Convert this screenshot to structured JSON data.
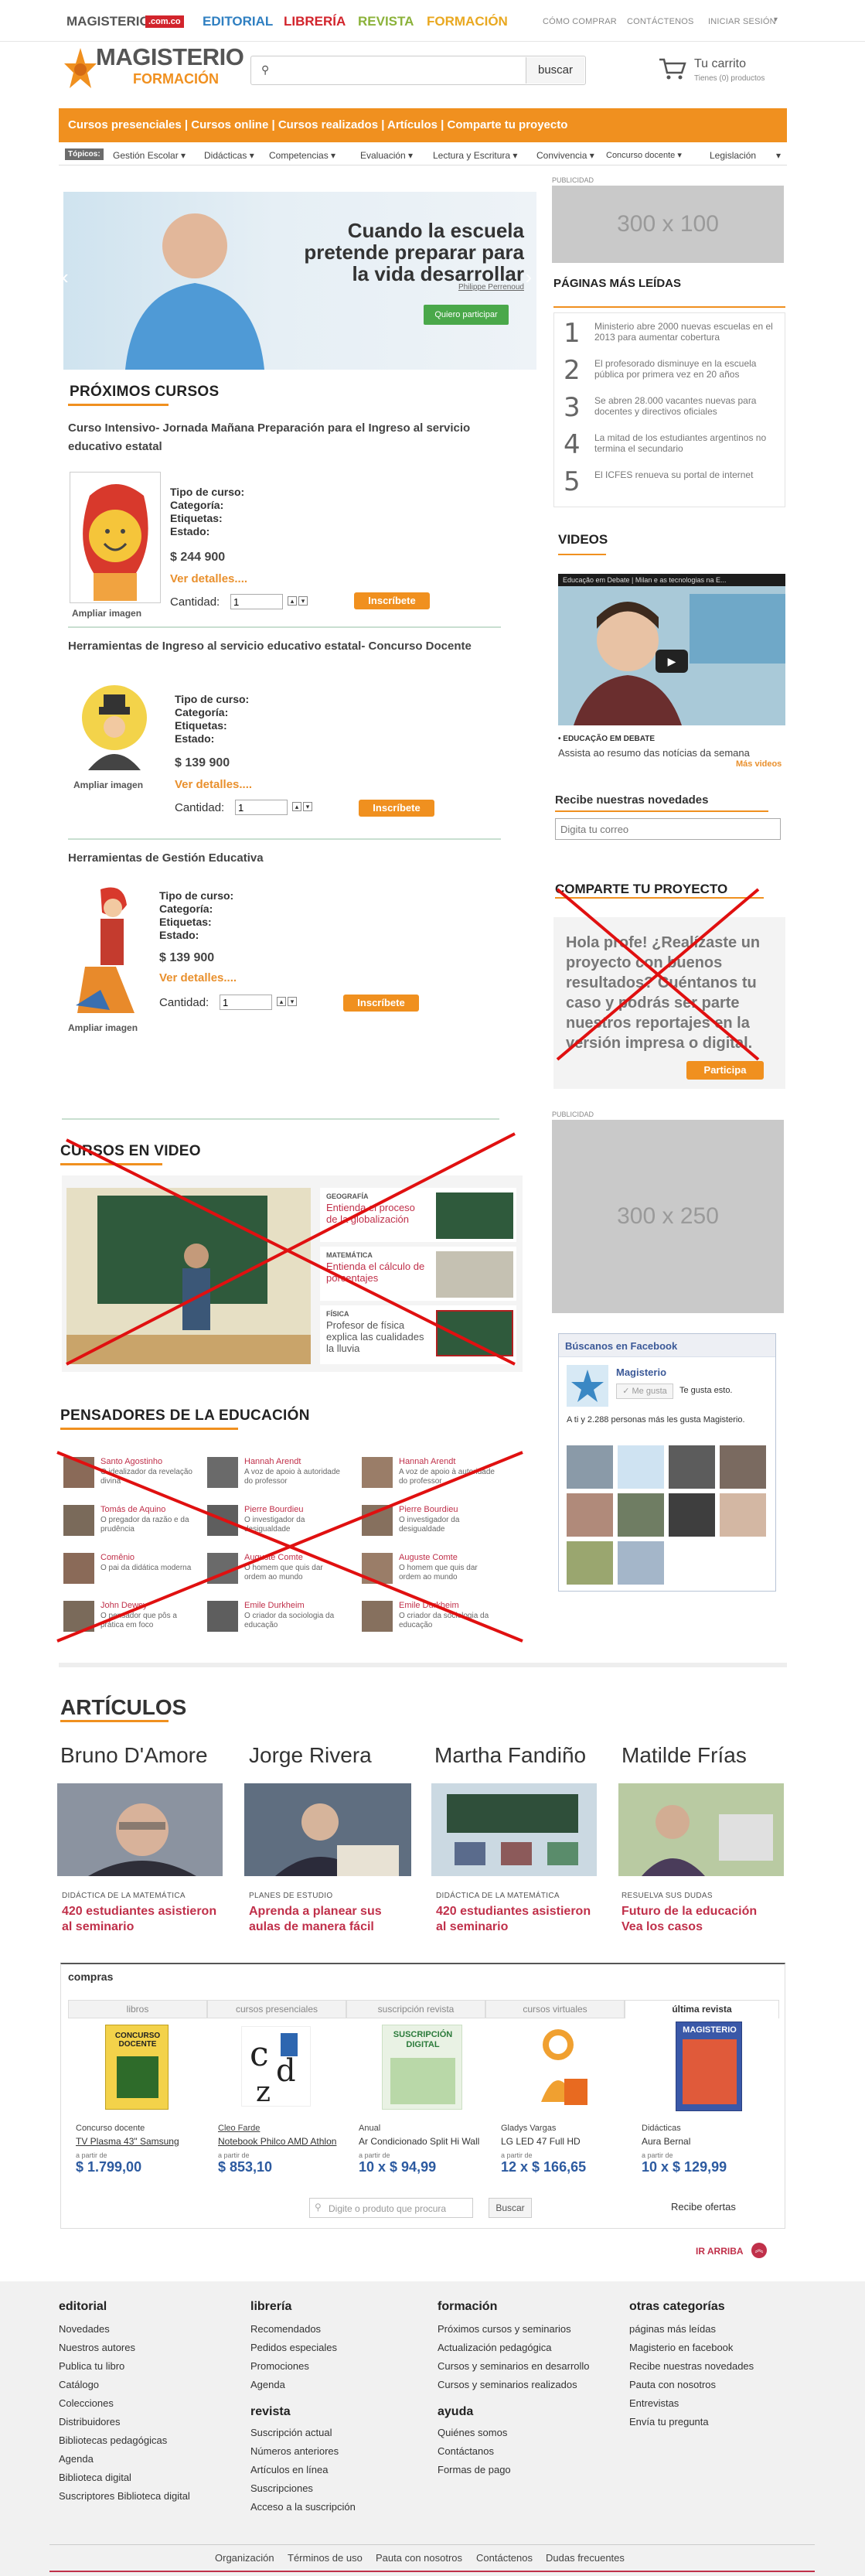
{
  "topbar": {
    "brands": [
      "MAGISTERIO",
      ".com.co",
      "EDITORIAL",
      "LIBRERÍA",
      "REVISTA",
      "FORMACIÓN"
    ],
    "links": [
      "CÓMO COMPRAR",
      "CONTÁCTENOS",
      "INICIAR SESIÓN"
    ]
  },
  "header": {
    "logo_main": "MAGISTERIO",
    "logo_sub": "FORMACIÓN",
    "search_placeholder": "",
    "search_button": "buscar",
    "cart_title": "Tu carrito",
    "cart_sub": "Tienes (0) productos"
  },
  "orange_nav": "Cursos presenciales | Cursos online | Cursos realizados | Artículos | Comparte tu proyecto",
  "subnav": {
    "label": "Tópicos:",
    "items": [
      "Gestión Escolar",
      "Didácticas",
      "Competencias",
      "Evaluación",
      "Lectura y Escritura",
      "Convivencia",
      "Concurso docente",
      "Legislación"
    ]
  },
  "hero": {
    "headline": "Cuando la escuela pretende preparar para la vida desarrollar",
    "author": "Philippe Perrenoud",
    "button": "Quiero participar"
  },
  "cursos": {
    "title": "PRÓXIMOS CURSOS",
    "image_caption": "Ampliar imagen",
    "fields": [
      "Tipo de curso:",
      "Categoría:",
      "Etiquetas:",
      "Estado:"
    ],
    "details": "Ver detalles....",
    "qty_label": "Cantidad:",
    "qty_value": "1",
    "button": "Inscríbete",
    "items": [
      {
        "title": "Curso Intensivo- Jornada Mañana Preparación para el Ingreso al servicio educativo estatal",
        "price": "$ 244 900"
      },
      {
        "title": "Herramientas de  Ingreso al servicio educativo estatal- Concurso Docente",
        "price": "$ 139 900"
      },
      {
        "title": "Herramientas de Gestión Educativa",
        "price": "$ 139 900"
      }
    ]
  },
  "sidebar": {
    "publicidad": "PUBLICIDAD",
    "ad1": "300 x 100",
    "ad2": "300 x 250",
    "mas_leidas_title": "PÁGINAS MÁS LEÍDAS",
    "mas_leidas": [
      {
        "n": "1",
        "text": "Ministerio abre 2000 nuevas escuelas en el 2013 para aumentar cobertura"
      },
      {
        "n": "2",
        "text": "El profesorado disminuye en la escuela pública por primera vez en 20 años"
      },
      {
        "n": "3",
        "text": "Se abren 28.000 vacantes nuevas para docentes y directivos oficiales"
      },
      {
        "n": "4",
        "text": "La mitad de los estudiantes argentinos no termina el secundario"
      },
      {
        "n": "5",
        "text": "El ICFES renueva su portal de internet"
      }
    ],
    "videos_title": "VIDEOS",
    "video_bar": "Educação em Debate | Milan e as tecnologias na E...",
    "video_caption_head": "• EDUCAÇÃO EM DEBATE",
    "video_caption": "Assista ao resumo das notícias da semana",
    "video_more": "Más videos",
    "newsletter_title": "Recibe nuestras novedades",
    "newsletter_placeholder": "Digita tu correo",
    "comparte_title": "COMPARTE TU PROYECTO",
    "comparte_text": "Hola profe! ¿Realízaste un proyecto con buenos resultados? Cuéntanos tu caso y podrás ser parte nuestros reportajes en la versión impresa o digital.",
    "comparte_button": "Participa",
    "fb_title": "Búscanos en Facebook",
    "fb_page": "Magisterio",
    "fb_like": "Me gusta",
    "fb_likes_this": "Te gusta esto.",
    "fb_count": "A ti y 2.288 personas más les gusta Magisterio."
  },
  "videos": {
    "title": "CURSOS EN VIDEO",
    "items": [
      {
        "cat": "GEOGRAFÍA",
        "text": "Entienda el proceso de la globalización"
      },
      {
        "cat": "MATEMÁTICA",
        "text": "Entienda el cálculo de porcentajes"
      },
      {
        "cat": "FÍSICA",
        "text": "Profesor de física explica las cualidades la lluvia"
      }
    ]
  },
  "pensadores": {
    "title": "PENSADORES DE LA EDUCACIÓN",
    "items": [
      {
        "name": "Santo Agostinho",
        "desc": "O idealizador da revelação divina"
      },
      {
        "name": "Hannah Arendt",
        "desc": "A voz de apoio à autoridade do professor"
      },
      {
        "name": "Hannah Arendt",
        "desc": "A voz de apoio à autoridade do professor"
      },
      {
        "name": "Tomás de Aquino",
        "desc": "O pregador da razão e da prudência"
      },
      {
        "name": "Pierre Bourdieu",
        "desc": "O investigador da desigualdade"
      },
      {
        "name": "Pierre Bourdieu",
        "desc": "O investigador da desigualdade"
      },
      {
        "name": "Comênio",
        "desc": "O pai da didática moderna"
      },
      {
        "name": "Auguste Comte",
        "desc": "O homem que quis dar ordem ao mundo"
      },
      {
        "name": "Auguste Comte",
        "desc": "O homem que quis dar ordem ao mundo"
      },
      {
        "name": "John Dewey",
        "desc": "O pensador que pôs a prática em foco"
      },
      {
        "name": "Emile Durkheim",
        "desc": "O criador da sociologia da educação"
      },
      {
        "name": "Emile Durkheim",
        "desc": "O criador da sociologia da educação"
      }
    ]
  },
  "articulos": {
    "title": "ARTÍCULOS",
    "items": [
      {
        "author": "Bruno D'Amore",
        "cat": "DIDÁCTICA DE LA MATEMÁTICA",
        "title": "420 estudiantes asistieron al seminario"
      },
      {
        "author": "Jorge Rivera",
        "cat": "PLANES DE ESTUDIO",
        "title": "Aprenda a planear sus aulas de manera fácil"
      },
      {
        "author": "Martha Fandiño",
        "cat": "DIDÁCTICA DE LA MATEMÁTICA",
        "title": "420 estudiantes asistieron al seminario"
      },
      {
        "author": "Matilde Frías",
        "cat": "RESUELVA SUS DUDAS",
        "title": "Futuro de la educación Vea los casos"
      }
    ]
  },
  "compras": {
    "title": "compras",
    "tabs": [
      "libros",
      "cursos presenciales",
      "suscripción revista",
      "cursos virtuales",
      "última revista"
    ],
    "products": [
      {
        "cat": "Concurso docente",
        "desc": "TV Plasma 43\" Samsung",
        "pre": "a partir de",
        "price": "$ 1.799,00"
      },
      {
        "cat": "Cleo Farde",
        "desc": "Notebook Philco AMD Athlon",
        "pre": "a partir de",
        "price": "$ 853,10"
      },
      {
        "cat": "Anual",
        "desc": "Ar Condicionado Split Hi Wall",
        "pre": "a partir de",
        "price": "10 x $ 94,99"
      },
      {
        "cat": "Gladys Vargas",
        "desc": "LG LED 47 Full HD",
        "pre": "a partir de",
        "price": "12 x $ 166,65"
      },
      {
        "cat": "Didácticas",
        "desc": "Aura Bernal",
        "pre": "a partir de",
        "price": "10 x $ 129,99"
      }
    ],
    "cover_text": [
      "CONCURSO DOCENTE",
      "SUSCRIPCIÓN DIGITAL",
      "MAGISTERIO"
    ],
    "search_placeholder": "Digite o produto que procura",
    "search_button": "Buscar",
    "recibe": "Recibe ofertas"
  },
  "ir_arriba": "IR ARRIBA",
  "footer": {
    "cols": [
      {
        "head": "editorial",
        "links": [
          "Novedades",
          "Nuestros autores",
          "Publica tu libro",
          "Catálogo",
          "Colecciones",
          "Distribuidores",
          "Bibliotecas pedagógicas",
          "Agenda",
          "Biblioteca digital",
          "Suscriptores Biblioteca digital"
        ]
      },
      {
        "head": "librería",
        "links": [
          "Recomendados",
          "Pedidos especiales",
          "Promociones",
          "Agenda"
        ]
      },
      {
        "head": "revista",
        "links": [
          "Suscripción actual",
          "Números anteriores",
          "Artículos en línea",
          "Suscripciones",
          "Acceso a la suscripción"
        ]
      },
      {
        "head": "formación",
        "links": [
          "Próximos cursos y seminarios",
          "Actualización pedagógica",
          "Cursos y seminarios en desarrollo",
          "Cursos y seminarios realizados"
        ]
      },
      {
        "head": "ayuda",
        "links": [
          "Quiénes somos",
          "Contáctanos",
          "Formas de pago"
        ]
      },
      {
        "head": "otras categorías",
        "links": [
          "páginas más leídas",
          "Magisterio en facebook",
          "Recibe nuestras novedades",
          "Pauta con nosotros",
          "Entrevistas",
          "Envía tu pregunta"
        ]
      }
    ],
    "bottom": [
      "Organización",
      "Términos de uso",
      "Pauta con nosotros",
      "Contáctenos",
      "Dudas frecuentes"
    ]
  },
  "colors": {
    "orange": "#f0901f",
    "red": "#e01010",
    "accent_pink": "#c0304a",
    "blue_price": "#2c5aa0"
  }
}
